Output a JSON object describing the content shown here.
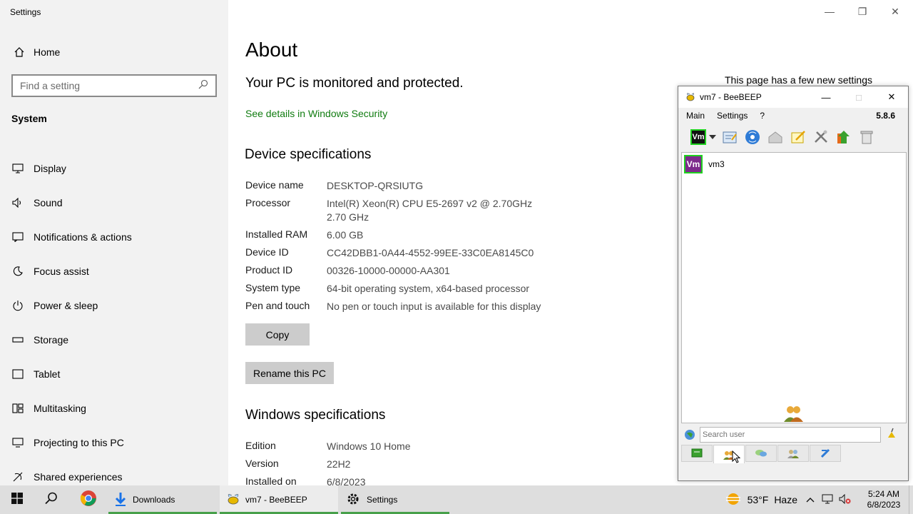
{
  "settings": {
    "app_title": "Settings",
    "home_label": "Home",
    "search_placeholder": "Find a setting",
    "section_title": "System",
    "nav": [
      {
        "label": "Display",
        "icon": "display-icon"
      },
      {
        "label": "Sound",
        "icon": "sound-icon"
      },
      {
        "label": "Notifications & actions",
        "icon": "notifications-icon"
      },
      {
        "label": "Focus assist",
        "icon": "focus-assist-icon"
      },
      {
        "label": "Power & sleep",
        "icon": "power-icon"
      },
      {
        "label": "Storage",
        "icon": "storage-icon"
      },
      {
        "label": "Tablet",
        "icon": "tablet-icon"
      },
      {
        "label": "Multitasking",
        "icon": "multitasking-icon"
      },
      {
        "label": "Projecting to this PC",
        "icon": "projecting-icon"
      },
      {
        "label": "Shared experiences",
        "icon": "shared-experiences-icon"
      }
    ],
    "page_title": "About",
    "protected_text": "Your PC is monitored and protected.",
    "security_link": "See details in Windows Security",
    "device_heading": "Device specifications",
    "device_specs": [
      {
        "key": "Device name",
        "value": "DESKTOP-QRSIUTG"
      },
      {
        "key": "Processor",
        "value": "Intel(R) Xeon(R) CPU E5-2697 v2 @ 2.70GHz   2.70 GHz"
      },
      {
        "key": "Installed RAM",
        "value": "6.00 GB"
      },
      {
        "key": "Device ID",
        "value": "CC42DBB1-0A44-4552-99EE-33C0EA8145C0"
      },
      {
        "key": "Product ID",
        "value": "00326-10000-00000-AA301"
      },
      {
        "key": "System type",
        "value": "64-bit operating system, x64-based processor"
      },
      {
        "key": "Pen and touch",
        "value": "No pen or touch input is available for this display"
      }
    ],
    "copy_button": "Copy",
    "rename_button": "Rename this PC",
    "windows_heading": "Windows specifications",
    "windows_specs": [
      {
        "key": "Edition",
        "value": "Windows 10 Home"
      },
      {
        "key": "Version",
        "value": "22H2"
      },
      {
        "key": "Installed on",
        "value": "6/8/2023"
      }
    ],
    "new_settings_text": "This page has a few new settings"
  },
  "beebeep": {
    "title": "vm7 - BeeBEEP",
    "menu": [
      "Main",
      "Settings",
      "?"
    ],
    "version": "5.8.6",
    "user_badge": "Vm",
    "toolbar_badge": "Vm",
    "users": [
      {
        "name": "vm3",
        "badge": "Vm"
      }
    ],
    "search_placeholder": "Search user",
    "toolbar_icons": [
      "status-icon",
      "profile-icon",
      "network-icon",
      "home-icon",
      "note-icon",
      "tools-icon",
      "update-icon",
      "trash-icon"
    ],
    "tab_icons": [
      "chat-tab-icon",
      "users-tab-icon",
      "messages-tab-icon",
      "groups-tab-icon",
      "plugins-tab-icon"
    ]
  },
  "taskbar": {
    "apps": [
      {
        "label": "Downloads",
        "icon": "downloads-icon"
      },
      {
        "label": "vm7 - BeeBEEP",
        "icon": "beebeep-icon"
      },
      {
        "label": "Settings",
        "icon": "settings-gear-icon"
      }
    ],
    "weather": "53°F",
    "weather_desc": "Haze",
    "time": "5:24 AM",
    "date": "6/8/2023"
  },
  "colors": {
    "accent_green": "#107c10",
    "badge_purple": "#7d2a8c",
    "taskbar_underline": "#47a04a"
  }
}
